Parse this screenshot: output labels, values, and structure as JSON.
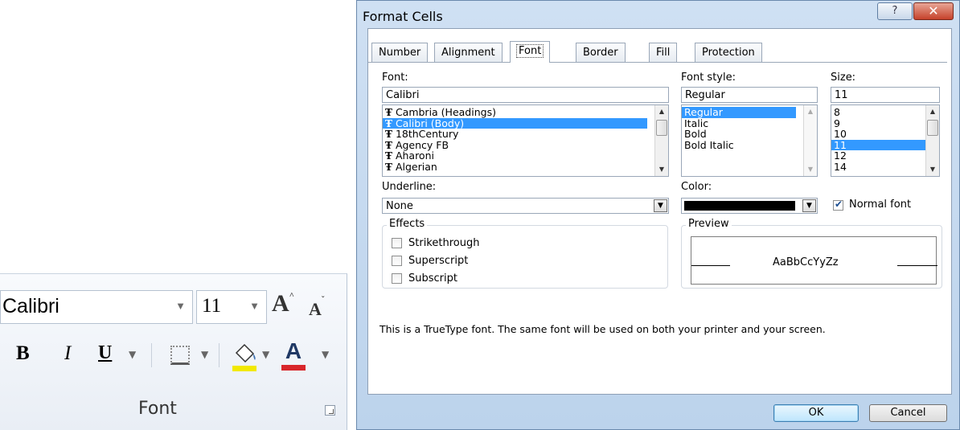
{
  "ribbon": {
    "font_name": "Calibri",
    "font_size": "11",
    "grow_glyph": "A",
    "shrink_glyph": "A",
    "bold": "B",
    "italic": "I",
    "underline": "U",
    "color_glyph": "A",
    "group_label": "Font",
    "icons": [
      "chevron-down-icon",
      "border-icon",
      "fill-bucket-icon",
      "font-color-icon",
      "dialog-launcher-icon"
    ],
    "colors": {
      "highlight": "#f2e900",
      "font_color": "#d8262b"
    }
  },
  "dialog": {
    "title": "Format Cells",
    "help_glyph": "?",
    "close_glyph": "✕",
    "tabs": [
      "Number",
      "Alignment",
      "Font",
      "Border",
      "Fill",
      "Protection"
    ],
    "active_tab": "Font",
    "font": {
      "label": "Font:",
      "value": "Calibri",
      "items": [
        "Cambria (Headings)",
        "Calibri (Body)",
        "18thCentury",
        "Agency FB",
        "Aharoni",
        "Algerian"
      ],
      "selected": "Calibri (Body)",
      "item_icon": "truetype-icon"
    },
    "style": {
      "label": "Font style:",
      "value": "Regular",
      "items": [
        "Regular",
        "Italic",
        "Bold",
        "Bold Italic"
      ],
      "selected": "Regular"
    },
    "size": {
      "label": "Size:",
      "value": "11",
      "items": [
        "8",
        "9",
        "10",
        "11",
        "12",
        "14"
      ],
      "selected": "11"
    },
    "underline": {
      "label": "Underline:",
      "value": "None"
    },
    "color": {
      "label": "Color:",
      "value": "#000000"
    },
    "normal_font": {
      "label": "Normal font",
      "checked": true
    },
    "effects": {
      "title": "Effects",
      "strikethrough": "Strikethrough",
      "superscript": "Superscript",
      "subscript": "Subscript"
    },
    "preview": {
      "title": "Preview",
      "sample": "AaBbCcYyZz"
    },
    "info": "This is a TrueType font.  The same font will be used on both your printer and your screen.",
    "ok": "OK",
    "cancel": "Cancel"
  }
}
